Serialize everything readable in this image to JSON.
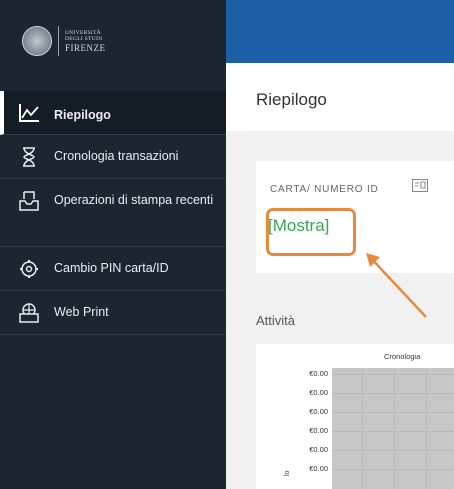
{
  "logo": {
    "line1": "UNIVERSITÀ",
    "line2": "DEGLI STUDI",
    "line3": "FIRENZE"
  },
  "nav": [
    {
      "label": "Riepilogo",
      "icon": "line-chart-icon",
      "active": true
    },
    {
      "label": "Cronologia transazioni",
      "icon": "hourglass-icon"
    },
    {
      "label": "Operazioni di stampa recenti",
      "icon": "printer-tray-icon"
    },
    {
      "label": "Cambio PIN carta/ID",
      "icon": "gear-icon"
    },
    {
      "label": "Web Print",
      "icon": "printer-globe-icon"
    }
  ],
  "page": {
    "title": "Riepilogo"
  },
  "card": {
    "label": "CARTA/ NUMERO ID",
    "link": "[Mostra]"
  },
  "activity": {
    "title": "Attività"
  },
  "chart_data": {
    "type": "bar",
    "title": "Cronologia",
    "y_tick_labels": [
      "€0.00",
      "€0.00",
      "€0.00",
      "€0.00",
      "€0.00",
      "€0.00"
    ],
    "ylabel": "lo"
  },
  "colors": {
    "sidebar": "#1b2631",
    "topbar": "#1d5fa7",
    "link": "#3aa655",
    "highlight": "#e88a3b"
  }
}
